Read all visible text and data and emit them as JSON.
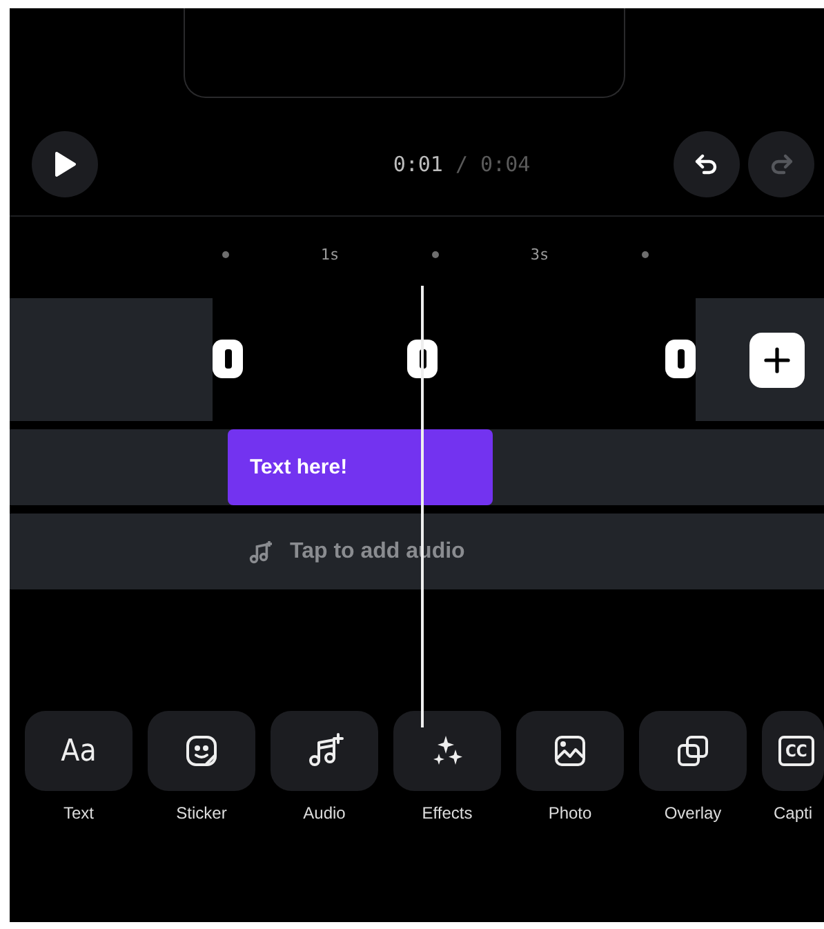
{
  "controls": {
    "time": {
      "current": "0:01",
      "total": "/ 0:04"
    },
    "undo": {
      "disabled": false
    },
    "redo": {
      "disabled": true
    }
  },
  "ruler": [
    {
      "kind": "dot"
    },
    {
      "kind": "label",
      "text": "1s"
    },
    {
      "kind": "dot"
    },
    {
      "kind": "label",
      "text": "3s"
    },
    {
      "kind": "dot"
    }
  ],
  "text_track": {
    "clip": "Text here!"
  },
  "audio_track": {
    "placeholder": "Tap to add audio"
  },
  "tools": [
    {
      "kind": "text",
      "glyph": "Aa",
      "label": "Text"
    },
    {
      "kind": "sticker",
      "label": "Sticker"
    },
    {
      "kind": "audio",
      "label": "Audio"
    },
    {
      "kind": "effects",
      "label": "Effects"
    },
    {
      "kind": "photo",
      "label": "Photo"
    },
    {
      "kind": "overlay",
      "label": "Overlay"
    },
    {
      "kind": "captions",
      "glyph": "CC",
      "label": "Capti"
    }
  ]
}
